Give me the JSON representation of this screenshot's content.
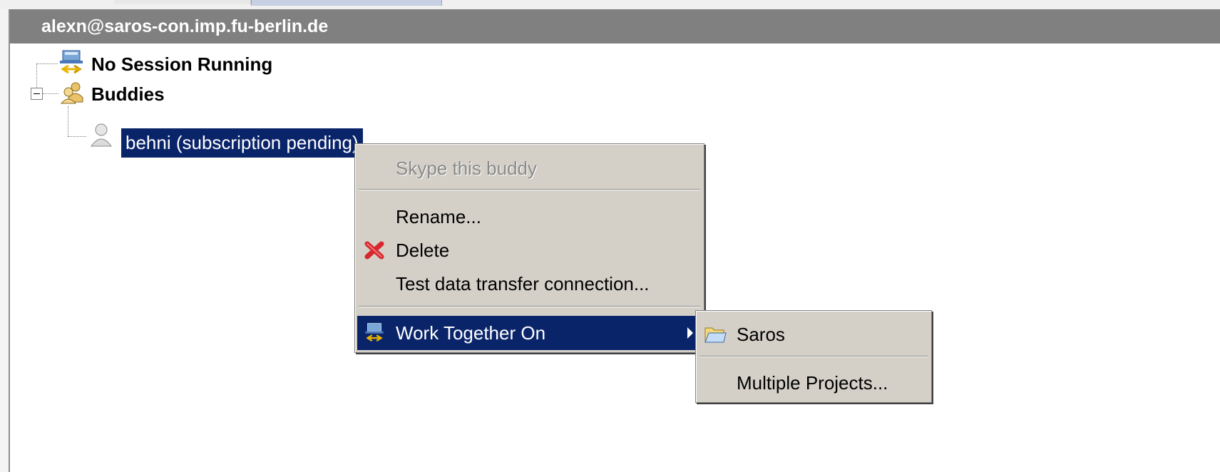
{
  "view": {
    "title": "alexn@saros-con.imp.fu-berlin.de"
  },
  "tree": {
    "session_label": "No Session Running",
    "buddies_label": "Buddies",
    "buddy_label": "behni (subscription pending)"
  },
  "context_menu": {
    "items": [
      {
        "label": "Skype this buddy",
        "enabled": false
      },
      {
        "label": "Rename...",
        "enabled": true
      },
      {
        "label": "Delete",
        "enabled": true,
        "icon": "red-x-icon"
      },
      {
        "label": "Test data transfer connection...",
        "enabled": true
      },
      {
        "label": "Work Together On",
        "enabled": true,
        "icon": "session-icon",
        "submenu": true,
        "highlighted": true
      }
    ]
  },
  "submenu": {
    "items": [
      {
        "label": "Saros",
        "icon": "folder-icon"
      },
      {
        "label": "Multiple Projects..."
      }
    ]
  },
  "colors": {
    "selection": "#0a246a",
    "header": "#808080",
    "menu": "#d4d0c8"
  }
}
